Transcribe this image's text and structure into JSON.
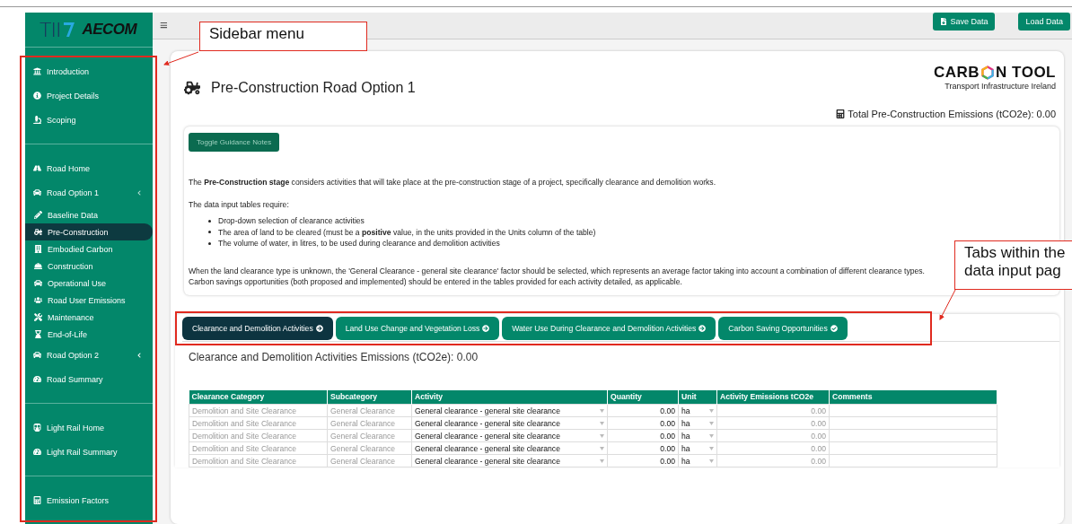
{
  "sidebar": {
    "logos": {
      "primary": "TII",
      "secondary": "AECOM"
    },
    "sections": [
      {
        "items": [
          {
            "label": "Introduction",
            "kind": "item",
            "selected": false
          },
          {
            "label": "Project Details",
            "kind": "item",
            "selected": false
          },
          {
            "label": "Scoping",
            "kind": "item",
            "selected": false
          }
        ]
      },
      {
        "items": [
          {
            "label": "Road Home",
            "kind": "item",
            "selected": false
          },
          {
            "label": "Road Option 1",
            "kind": "group",
            "expanded": true,
            "selected": false,
            "children": [
              {
                "label": "Baseline Data",
                "selected": false
              },
              {
                "label": "Pre-Construction",
                "selected": true
              },
              {
                "label": "Embodied Carbon",
                "selected": false
              },
              {
                "label": "Construction",
                "selected": false
              },
              {
                "label": "Operational Use",
                "selected": false
              },
              {
                "label": "Road User Emissions",
                "selected": false
              },
              {
                "label": "Maintenance",
                "selected": false
              },
              {
                "label": "End-of-Life",
                "selected": false
              }
            ]
          },
          {
            "label": "Road Option 2",
            "kind": "group",
            "expanded": false,
            "selected": false
          },
          {
            "label": "Road Summary",
            "kind": "item",
            "selected": false
          }
        ]
      },
      {
        "items": [
          {
            "label": "Light Rail Home",
            "kind": "item",
            "selected": false
          },
          {
            "label": "Light Rail Summary",
            "kind": "item",
            "selected": false
          }
        ]
      },
      {
        "items": [
          {
            "label": "Emission Factors",
            "kind": "item",
            "selected": false
          }
        ]
      }
    ]
  },
  "toolbar": {
    "menu_glyph": "≡",
    "buttons": [
      {
        "label": "Save Data",
        "kind": "save"
      },
      {
        "label": "Load Data",
        "kind": "plain"
      }
    ]
  },
  "page": {
    "title": "Pre-Construction Road Option 1",
    "brand": {
      "before": "CARB",
      "after": "N TOOL",
      "subtitle": "Transport Infrastructure Ireland"
    },
    "total": "Total Pre-Construction Emissions (tCO2e): 0.00",
    "guidance": {
      "button": "Toggle Guidance Notes",
      "intro": "The **Pre-Construction stage** considers activities that will take place at the pre-construction stage of a project, specifically clearance and demolition works.",
      "lead": "The data input tables require:",
      "bullets": [
        "Drop-down selection of clearance activities",
        "The area of land to be cleared (must be a **positive** value, in the units provided in the Units column of the table)",
        "The volume of water, in litres, to be used during clearance and demolition activities"
      ],
      "notes": [
        "When the land clearance type is unknown, the 'General Clearance - general site clearance' factor should be selected, which represents an average factor taking into account a combination of different clearance types.",
        "Carbon savings opportunities (both proposed and implemented) should be entered in the tables provided for each activity detailed, as applicable."
      ]
    },
    "tabs": [
      {
        "label": "Clearance and Demolition Activities",
        "kind": "arrow",
        "selected": true
      },
      {
        "label": "Land Use Change and Vegetation Loss",
        "kind": "arrow",
        "selected": false
      },
      {
        "label": "Water Use During Clearance and Demolition Activities",
        "kind": "arrow",
        "selected": false
      },
      {
        "label": "Carbon Saving Opportunities",
        "kind": "check",
        "selected": false
      }
    ],
    "section_total": "Clearance and Demolition Activities Emissions (tCO2e): 0.00",
    "table": {
      "columns": [
        "Clearance Category",
        "Subcategory",
        "Activity",
        "Quantity",
        "Unit",
        "Activity Emissions tCO2e",
        "Comments"
      ],
      "rows": [
        [
          "Demolition and Site Clearance",
          "General Clearance",
          "General clearance - general site clearance",
          "0.00",
          "ha",
          "0.00"
        ],
        [
          "Demolition and Site Clearance",
          "General Clearance",
          "General clearance - general site clearance",
          "0.00",
          "ha",
          "0.00"
        ],
        [
          "Demolition and Site Clearance",
          "General Clearance",
          "General clearance - general site clearance",
          "0.00",
          "ha",
          "0.00"
        ],
        [
          "Demolition and Site Clearance",
          "General Clearance",
          "General clearance - general site clearance",
          "0.00",
          "ha",
          "0.00"
        ],
        [
          "Demolition and Site Clearance",
          "General Clearance",
          "General clearance - general site clearance",
          "0.00",
          "ha",
          "0.00"
        ]
      ]
    }
  },
  "annotations": [
    {
      "lines": [
        "Sidebar menu"
      ],
      "kind": "sidebar"
    },
    {
      "lines": [
        "Tabs within the",
        "data input pag"
      ],
      "kind": "tabs"
    }
  ]
}
